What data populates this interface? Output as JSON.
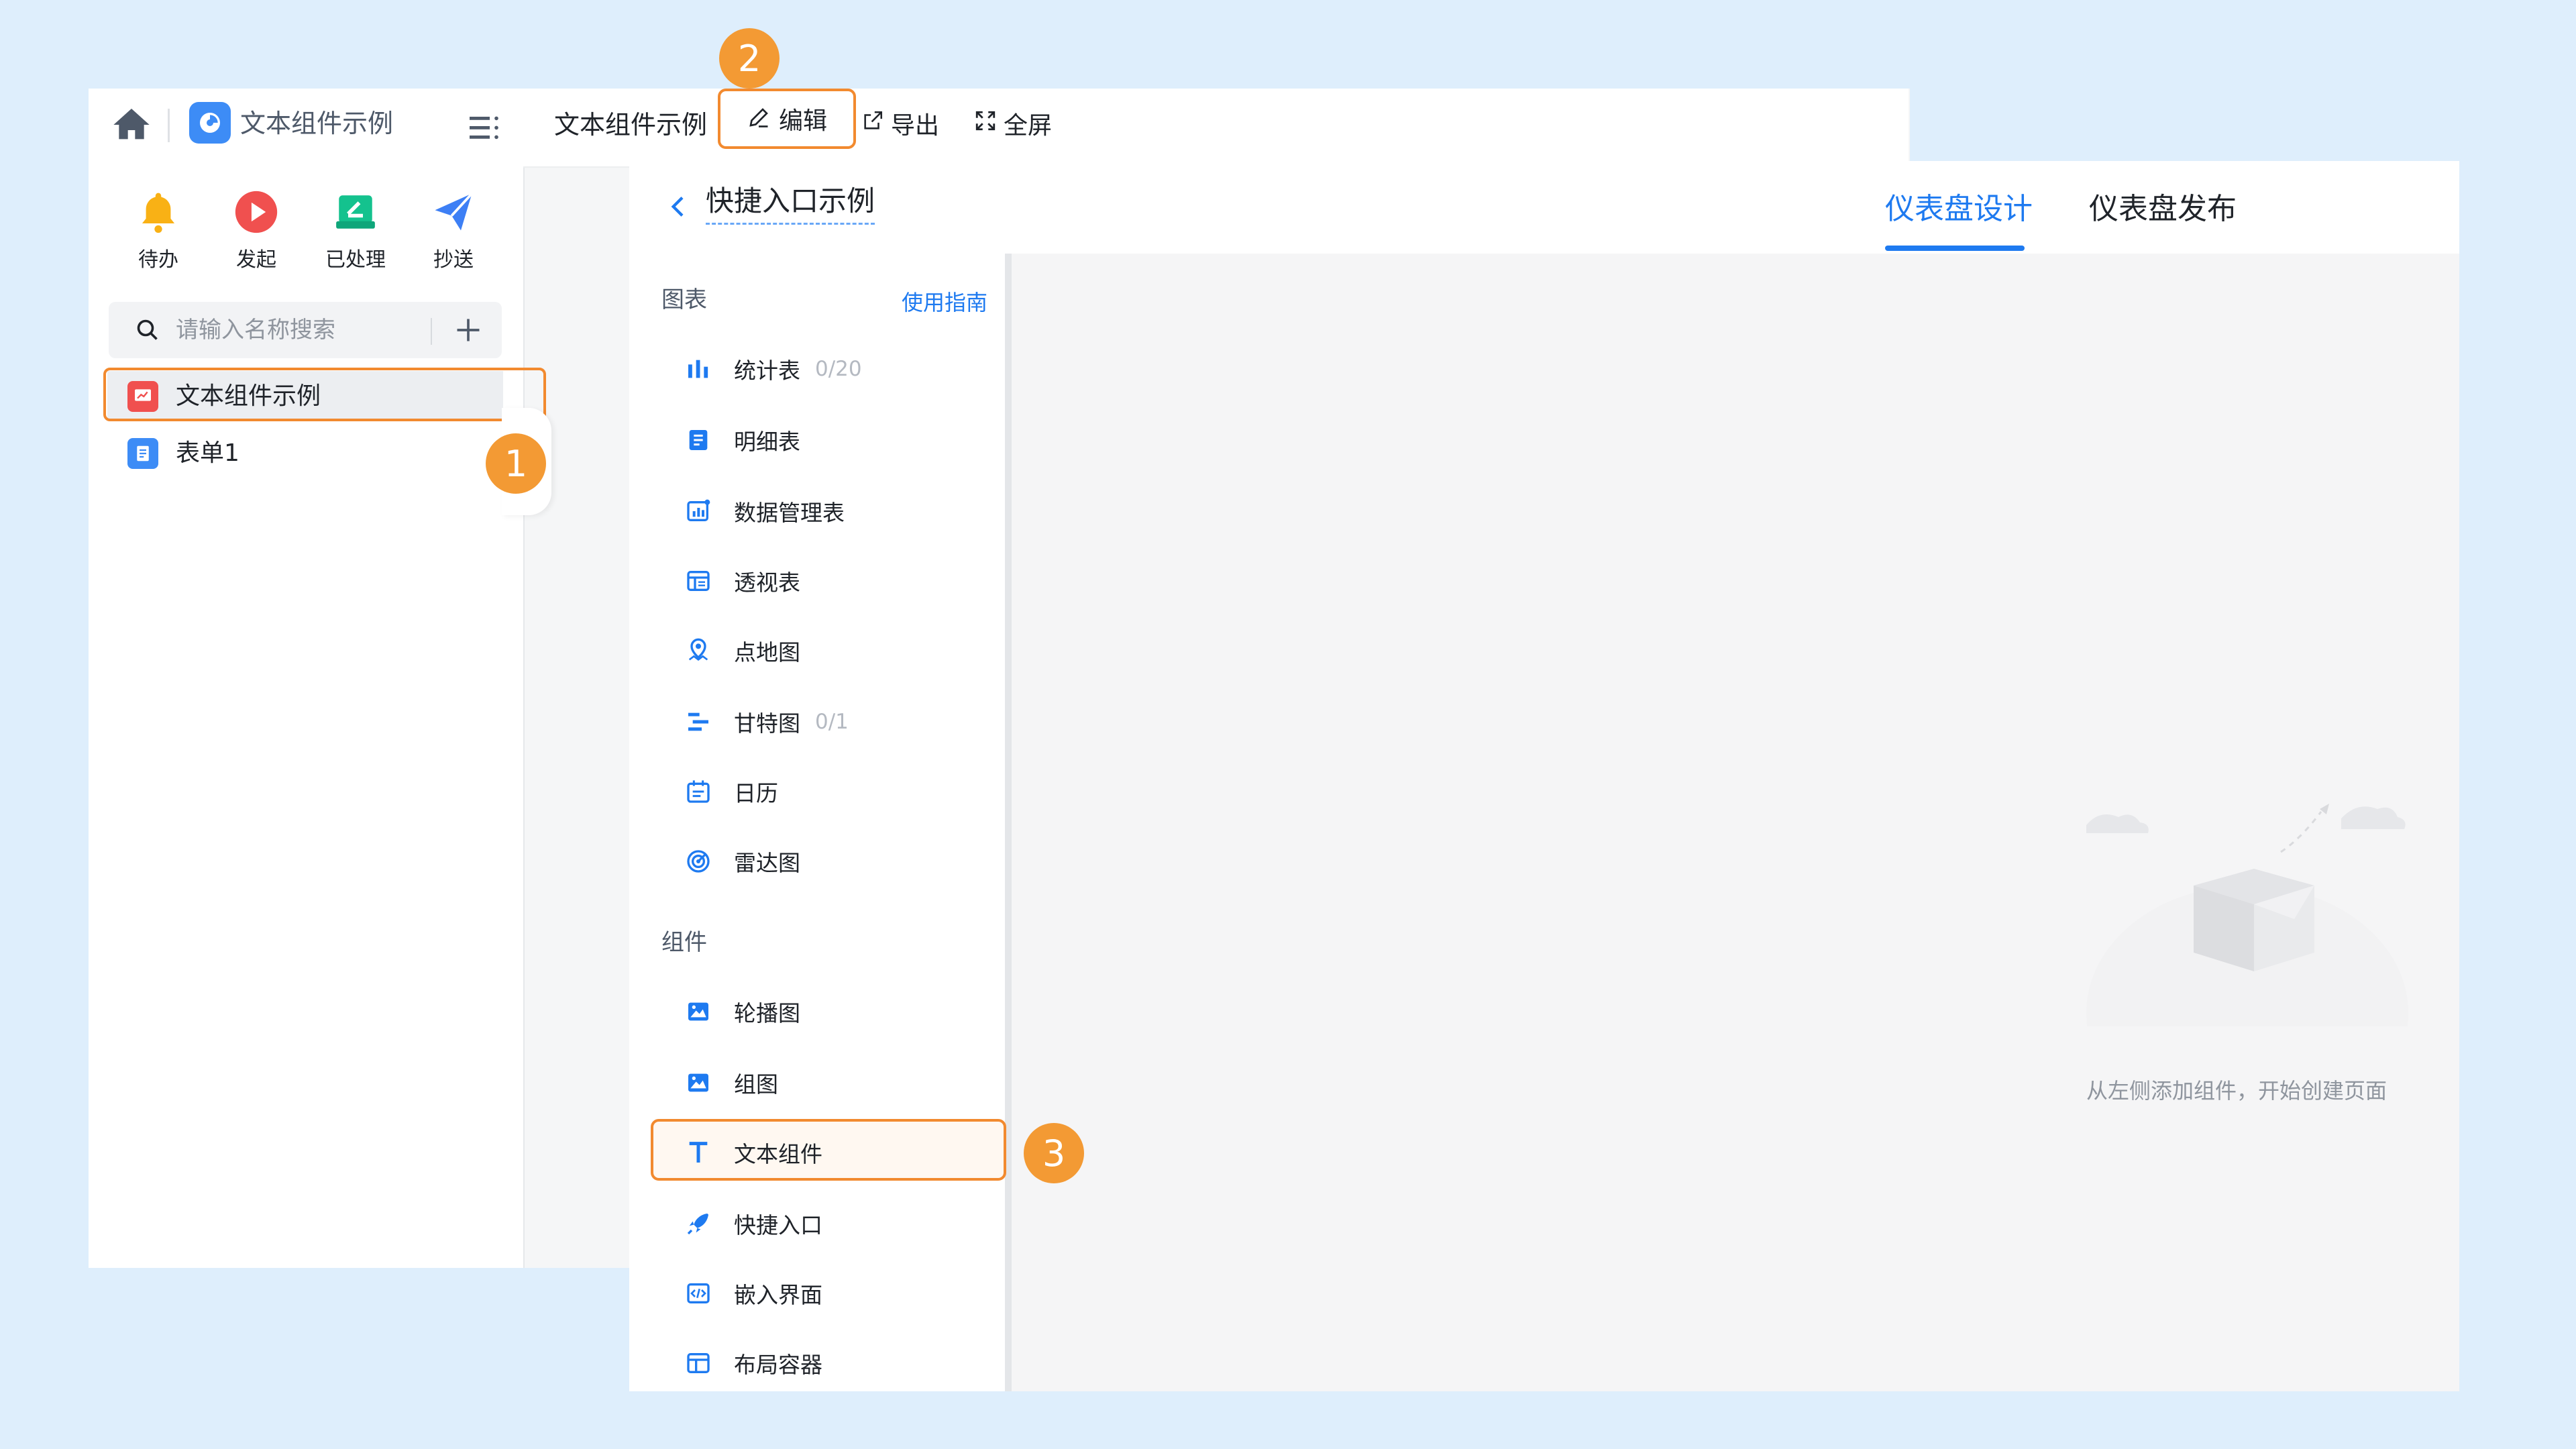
{
  "app": {
    "title": "文本组件示例",
    "icons": {
      "home": "home-icon",
      "menu": "menu-list-icon",
      "app": "app-badge-icon"
    }
  },
  "quick_actions": [
    {
      "label": "待办",
      "icon": "bell-icon",
      "color": "#f9b115"
    },
    {
      "label": "发起",
      "icon": "play-icon",
      "color": "#f0504f"
    },
    {
      "label": "已处理",
      "icon": "done-box-icon",
      "color": "#14c28e"
    },
    {
      "label": "抄送",
      "icon": "send-plane-icon",
      "color": "#3d7ff5"
    }
  ],
  "search": {
    "placeholder": "请输入名称搜索"
  },
  "tree": [
    {
      "label": "文本组件示例",
      "icon": "dashboard-icon",
      "color": "#f0504f",
      "selected": true
    },
    {
      "label": "表单1",
      "icon": "form-icon",
      "color": "#3d8cf6",
      "selected": false
    }
  ],
  "topbar": {
    "title": "文本组件示例",
    "edit": "编辑",
    "export": "导出",
    "fullscreen": "全屏"
  },
  "editor": {
    "title": "快捷入口示例",
    "tabs": [
      {
        "label": "仪表盘设计",
        "active": true
      },
      {
        "label": "仪表盘发布",
        "active": false
      }
    ]
  },
  "components": {
    "charts_title": "图表",
    "guide": "使用指南",
    "charts": [
      {
        "label": "统计表",
        "count": "0/20",
        "icon": "bar-chart-icon"
      },
      {
        "label": "明细表",
        "icon": "detail-table-icon"
      },
      {
        "label": "数据管理表",
        "icon": "data-manage-icon"
      },
      {
        "label": "透视表",
        "icon": "pivot-table-icon"
      },
      {
        "label": "点地图",
        "icon": "map-pin-icon"
      },
      {
        "label": "甘特图",
        "count": "0/1",
        "icon": "gantt-icon"
      },
      {
        "label": "日历",
        "icon": "calendar-icon"
      },
      {
        "label": "雷达图",
        "icon": "radar-icon"
      }
    ],
    "widgets_title": "组件",
    "widgets": [
      {
        "label": "轮播图",
        "icon": "carousel-image-icon"
      },
      {
        "label": "组图",
        "icon": "image-group-icon"
      },
      {
        "label": "文本组件",
        "icon": "text-t-icon"
      },
      {
        "label": "快捷入口",
        "icon": "rocket-icon"
      },
      {
        "label": "嵌入界面",
        "icon": "embed-code-icon"
      },
      {
        "label": "布局容器",
        "icon": "layout-container-icon"
      }
    ]
  },
  "canvas": {
    "empty_text": "从左侧添加组件，开始创建页面"
  },
  "annotations": [
    "1",
    "2",
    "3"
  ],
  "colors": {
    "accent": "#1e7af0",
    "highlight": "#f28a2f",
    "badge": "#f39a34"
  }
}
